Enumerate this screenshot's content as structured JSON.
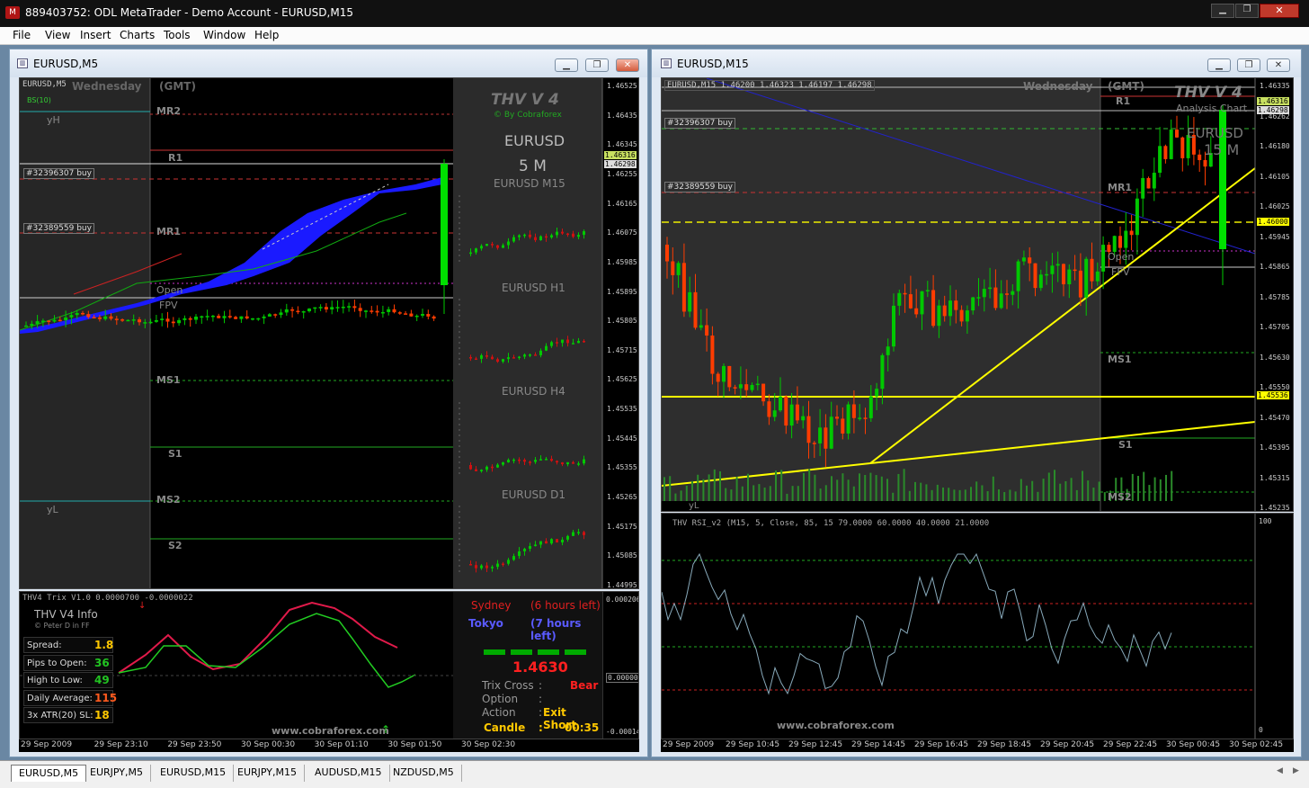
{
  "title_bar": {
    "text": "889403752: ODL MetaTrader - Demo Account - EURUSD,M15"
  },
  "menu": [
    "File",
    "View",
    "Insert",
    "Charts",
    "Tools",
    "Window",
    "Help"
  ],
  "left_window": {
    "title": "EURUSD,M5",
    "info_line": "EURUSD,M5",
    "day_label": "Wednesday",
    "gmt_label": "(GMT)",
    "bs_label": "BS(10)",
    "pivot_labels": {
      "mr2": "MR2",
      "r1": "R1",
      "mr1": "MR1",
      "open": "Open",
      "fpv": "FPV",
      "ms1": "MS1",
      "s1": "S1",
      "ms2": "MS2",
      "s2": "S2",
      "yh": "yH",
      "yl": "yL"
    },
    "order_labels": [
      "#32396307 buy",
      "#32389559 buy"
    ],
    "price_axis": [
      "1.46525",
      "1.46435",
      "1.46345",
      "1.46255",
      "1.46165",
      "1.46075",
      "1.45985",
      "1.45895",
      "1.45805",
      "1.45715",
      "1.45625",
      "1.45535",
      "1.45445",
      "1.45355",
      "1.45265",
      "1.45175",
      "1.45085",
      "1.44995"
    ],
    "price_tags": [
      "1.46316",
      "1.46298"
    ],
    "time_axis": [
      "29 Sep 2009",
      "29 Sep 23:10",
      "29 Sep 23:50",
      "30 Sep 00:30",
      "30 Sep 01:10",
      "30 Sep 01:50",
      "30 Sep 02:30"
    ],
    "panel": {
      "brand": "THV V 4",
      "byline": "© By Cobraforex",
      "symbol": "EURUSD",
      "timeframe": "5 M",
      "mini": [
        "EURUSD M15",
        "EURUSD H1",
        "EURUSD H4",
        "EURUSD D1"
      ]
    },
    "sub": {
      "header": "THV4 Trix V1.0 0.0000700 -0.0000022",
      "axis": [
        "0.000206",
        "0.00000",
        "-0.00014"
      ],
      "info_title": "THV  V4  Info",
      "info_byline": "© Peter D in FF",
      "rows": [
        {
          "label": "Spread:",
          "value": "1.8",
          "color": "#ffc800"
        },
        {
          "label": "Pips to Open:",
          "value": "36",
          "color": "#22c422"
        },
        {
          "label": "High to Low:",
          "value": "49",
          "color": "#22c422"
        },
        {
          "label": "Daily Average:",
          "value": "115",
          "color": "#ff5a1e"
        },
        {
          "label": "3x ATR(20) SL:",
          "value": "18",
          "color": "#ffc800"
        }
      ],
      "website": "www.cobraforex.com",
      "sessions": [
        {
          "name": "Sydney",
          "time": "(6 hours left)",
          "color": "#e02020"
        },
        {
          "name": "Tokyo",
          "time": "(7 hours left)",
          "color": "#5a5aff"
        }
      ],
      "price": "1.4630",
      "trix_label": "Trix Cross",
      "trix_value": "Bear",
      "option_label": "Option",
      "action_label": "Action",
      "action_value": "Exit Short",
      "candle_label": "Candle",
      "candle_value": "00:35"
    }
  },
  "right_window": {
    "title": "EURUSD,M15",
    "info_line": "EURUSD,M15  1.46200 1.46323 1.46197 1.46298",
    "day_label": "Wednesday",
    "gmt_label": "(GMT)",
    "brand": "THV V 4",
    "analysis": "Analysis Chart",
    "symbol": "EURUSD",
    "timeframe": "15 M",
    "pivot_labels": {
      "r1": "R1",
      "mr1": "MR1",
      "open": "Open",
      "fpv": "FPV",
      "ms1": "MS1",
      "s1": "S1",
      "ms2": "MS2",
      "yl": "yL"
    },
    "order_labels": [
      "#32396307 buy",
      "#32389559 buy"
    ],
    "price_axis": [
      "1.46335",
      "1.46262",
      "1.46180",
      "1.46105",
      "1.46025",
      "1.45945",
      "1.45865",
      "1.45785",
      "1.45705",
      "1.45630",
      "1.45550",
      "1.45470",
      "1.45395",
      "1.45315",
      "1.45235"
    ],
    "price_tags": [
      "1.46316",
      "1.46298",
      "1.46000",
      "1.45536"
    ],
    "time_axis": [
      "29 Sep 2009",
      "29 Sep 10:45",
      "29 Sep 12:45",
      "29 Sep 14:45",
      "29 Sep 16:45",
      "29 Sep 18:45",
      "29 Sep 20:45",
      "29 Sep 22:45",
      "30 Sep 00:45",
      "30 Sep 02:45"
    ],
    "rsi_header": "THV RSI_v2  (M15,  5,  Close,  85,  15 79.0000 60.0000 40.0000 21.0000",
    "rsi_axis": [
      "100",
      "0"
    ],
    "website": "www.cobraforex.com"
  },
  "tabs": [
    "EURUSD,M5",
    "EURJPY,M5",
    "EURUSD,M15",
    "EURJPY,M15",
    "AUDUSD,M15",
    "NZDUSD,M5"
  ],
  "colors": {
    "bull": "#00c800",
    "bear": "#ff3c00",
    "pivot_red": "#cc2222",
    "pivot_green": "#22aa22",
    "yellow": "#ffff00",
    "cloud": "#1a1aff"
  }
}
